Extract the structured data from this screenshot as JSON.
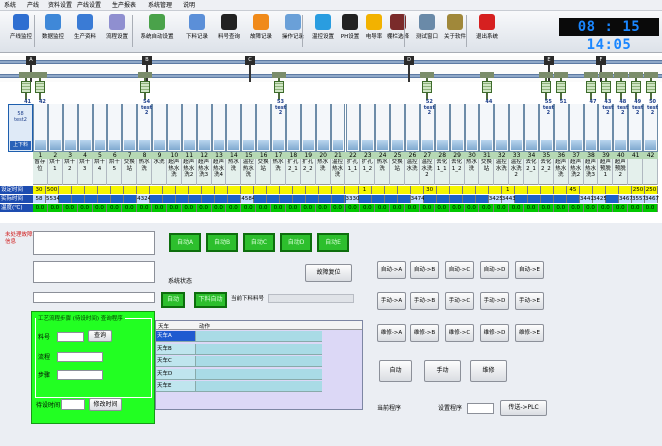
{
  "menu": [
    "系统",
    "产线",
    "资料设置",
    "产线设置",
    "生产报表",
    "系统管理",
    "说明"
  ],
  "toolbar": [
    {
      "label": "产线监控",
      "icon": "monitor-icon",
      "color": "#2f6fd1"
    },
    {
      "label": "数据监控",
      "icon": "data-monitor-icon",
      "color": "#3f88d8"
    },
    {
      "label": "生产资料",
      "icon": "document-icon",
      "color": "#3a7bd5"
    },
    {
      "label": "流程设置",
      "icon": "gear-icon",
      "color": "#8f8fd0"
    },
    {
      "label": "系统自动设置",
      "icon": "people-icon",
      "color": "#4aa24a"
    },
    {
      "label": "下料记录",
      "icon": "search-icon",
      "color": "#5b8fd8"
    },
    {
      "label": "料号查询",
      "icon": "barcode-icon",
      "color": "#222222"
    },
    {
      "label": "故障记录",
      "icon": "warning-icon",
      "color": "#f08a1a"
    },
    {
      "label": "操作记录",
      "icon": "disk-icon",
      "color": "#6aa0d8"
    },
    {
      "label": "温控设置",
      "icon": "thermometer-icon",
      "color": "#2a9de0"
    },
    {
      "label": "PH设置",
      "icon": "ph-icon",
      "color": "#222222"
    },
    {
      "label": "电导率",
      "icon": "lightning-icon",
      "color": "#f2b200"
    },
    {
      "label": "棚栏选择",
      "icon": "fence-icon",
      "color": "#7a2b2b"
    },
    {
      "label": "测试窗口",
      "icon": "window-icon",
      "color": "#6a8aa8"
    },
    {
      "label": "关于软件",
      "icon": "building-icon",
      "color": "#a0883a"
    },
    {
      "label": "退出系统",
      "icon": "exit-icon",
      "color": "#d62020"
    }
  ],
  "clock": "08 : 15 14:05",
  "cranes": [
    "A",
    "B",
    "C",
    "D",
    "E",
    "F"
  ],
  "loader": {
    "top": "58\ntest2",
    "button": "上下料"
  },
  "tank_numbers": [
    "1",
    "2",
    "3",
    "4",
    "5",
    "6",
    "7",
    "8",
    "9",
    "10",
    "11",
    "12",
    "13",
    "14",
    "15",
    "16",
    "17",
    "18",
    "19",
    "20",
    "21",
    "22",
    "23",
    "24",
    "25",
    "26",
    "27",
    "28",
    "29",
    "30",
    "31",
    "32",
    "33",
    "34",
    "35",
    "36",
    "37",
    "38",
    "39",
    "40",
    "41",
    "42"
  ],
  "tank_names": [
    "暂存位",
    "烘干1",
    "烘干2",
    "烘干3",
    "烘干4",
    "烘干5",
    "交换站",
    "热水洗",
    "水洗",
    "超声热水洗",
    "超声热水洗2",
    "超声热水洗3",
    "超声热水洗4",
    "热水洗",
    "温控热水洗",
    "交换站",
    "热水洗",
    "扩孔2_1",
    "扩孔2_2",
    "热水洗",
    "温控热水洗",
    "扩孔1_1",
    "扩孔1_2",
    "热水洗",
    "交换站",
    "温控水洗",
    "温控水洗2",
    "去化1_1",
    "去化1_2",
    "热水洗",
    "交换站",
    "温控水洗",
    "温控水洗2",
    "去化2_1",
    "去化2_2",
    "超声热水洗",
    "超声热水洗2",
    "超声热水洗3",
    "超声预脱1",
    "超声预脱2",
    "",
    ""
  ],
  "tank_tops": {
    "0": "41",
    "1": "42",
    "8": "54\ntest\n2",
    "17": "53\ntest\n2",
    "27": "52\ntest\n2",
    "31": "44",
    "35": "55\ntest\n2",
    "36": "51",
    "38": "47",
    "39": "43\ntest\n2",
    "40": "48\ntest\n2",
    "41": "49\ntest\n2",
    "42": "50\ntest\n2"
  },
  "row_labels": {
    "set": "设定时间",
    "actual": "实际时间",
    "temp": "温度(℃)"
  },
  "set_times": [
    "30",
    "500",
    "",
    "",
    "",
    "",
    "",
    "",
    "",
    "",
    "",
    "",
    "",
    "",
    "",
    "",
    "",
    "",
    "",
    "",
    "",
    "",
    "",
    "",
    "",
    "1",
    "",
    "",
    "",
    "",
    "30",
    "",
    "",
    "",
    "",
    "",
    "1",
    "",
    "",
    "",
    "",
    "45",
    "",
    "",
    "",
    "",
    "250",
    "250"
  ],
  "actual_times": [
    "58",
    "5534",
    "",
    "",
    "",
    "",
    "",
    "",
    "4324",
    "",
    "",
    "",
    "",
    "",
    "",
    "",
    "4584",
    "",
    "",
    "",
    "",
    "",
    "",
    "",
    "3330",
    "",
    "",
    "",
    "",
    "3474",
    "",
    "",
    "",
    "",
    "",
    "3425",
    "3443",
    "",
    "",
    "",
    "",
    "",
    "3441",
    "3425",
    "",
    "3467",
    "3557",
    "3467"
  ],
  "temps": [
    "0.0",
    "0.0",
    "0.0",
    "0.0",
    "0.0",
    "0.0",
    "0.0",
    "0.0",
    "0.0",
    "0.0",
    "0.0",
    "0.0",
    "0.0",
    "0.0",
    "0.0",
    "0.0",
    "0.0",
    "0.0",
    "0.0",
    "0.0",
    "0.0",
    "0.0",
    "0.0",
    "0.0",
    "0.0",
    "0.0",
    "0.0",
    "0.0",
    "0.0",
    "0.0",
    "0.0",
    "0.0",
    "0.0",
    "0.0",
    "0.0",
    "0.0",
    "0.0",
    "0.0",
    "0.0",
    "0.0",
    "0.0",
    "0.0"
  ],
  "fault_label": "未处理故障信息",
  "status_buttons": [
    "自动A",
    "自动B",
    "自动C",
    "自动D",
    "自动E"
  ],
  "fault_reset": "故障复位",
  "system_status_label": "系统状态",
  "system_buttons": [
    "自动",
    "下料自动"
  ],
  "current_part_label": "当前下料料号",
  "craft": {
    "title": "工艺流程步骤 (待设时间) 查询程序",
    "part_label": "料号",
    "query_button": "查询",
    "flow_label": "流程",
    "step_label": "步骤",
    "time_label": "待设时间",
    "modify_button": "修改时间"
  },
  "table": {
    "headers": [
      "天车",
      "动作"
    ],
    "rows": [
      "天车A",
      "天车B",
      "天车C",
      "天车D",
      "天车E"
    ]
  },
  "control_rows": [
    [
      "自动->A",
      "自动->B",
      "自动->C",
      "自动->D",
      "自动->E"
    ],
    [
      "手动->A",
      "手动->B",
      "手动->C",
      "手动->D",
      "手动->E"
    ],
    [
      "维修->A",
      "维修->B",
      "维修->C",
      "维修->D",
      "维修->E"
    ]
  ],
  "mode_buttons": [
    "自动",
    "手动",
    "维修"
  ],
  "bottom": {
    "current_program": "当前程序",
    "set_program": "设置程序",
    "send_button": "传送->PLC"
  }
}
